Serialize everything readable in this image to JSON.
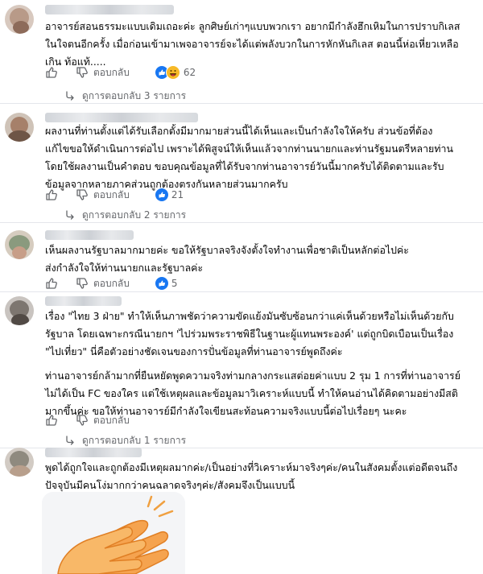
{
  "comments": [
    {
      "text_lines": [
        "อาจารย์สอนธรรมะแบบเดิมเถอะค่ะ ลูกศิษย์เก่าๆแบบพวกเรา อยากมีกำลังฮึกเหิมในการปราบกิเลส",
        "ในใจตนอีกครั้ง เมื่อก่อนเข้ามาเพจอาจารย์จะได้แต่พลังบวกในการหักหันกิเลส ตอนนี้ห่อเหี่ยวเหลือ",
        "เกิน ท้อแท้....."
      ],
      "reply_label": "ตอบกลับ",
      "reaction_count": "62",
      "replies_label": "ดูการตอบกลับ 3 รายการ"
    },
    {
      "text_lines": [
        "ผลงานที่ท่านตั้งแต่ได้รับเลือกตั้งมีมากมายส่วนนี้ได้เห็นและเป็นกำลังใจให้ครับ ส่วนข้อที่ต้อง",
        "แก้ไขขอให้ดำเนินการต่อไป เพราะได้พิสูจน์ให้เห็นแล้วจากท่านนายกและท่านรัฐมนตรีหลายท่าน",
        "โดยใช้ผลงานเป็นคำตอบ ขอบคุณข้อมูลที่ได้รับจากท่านอาจารย์วันนี้มากครับได้ติดตามและรับ",
        "ข้อมูลจากหลายภาคส่วนถูกต้องตรงกันหลายส่วนมากครับ"
      ],
      "reply_label": "ตอบกลับ",
      "reaction_count": "21",
      "replies_label": "ดูการตอบกลับ 2 รายการ"
    },
    {
      "text_lines": [
        "เห็นผลงานรัฐบาลมากมายค่ะ ขอให้รัฐบาลจริงจังตั้งใจทำงานเพื่อชาติเป็นหลักต่อไปค่ะ",
        "ส่งกำลังใจให้ท่านนายกและรัฐบาลค่ะ"
      ],
      "reply_label": "ตอบกลับ",
      "reaction_count": "5"
    },
    {
      "paragraph1_lines": [
        "เรื่อง \"ไทย 3 ฝ่าย\" ทำให้เห็นภาพชัดว่าความขัดแย้งมันซับซ้อนกว่าแค่เห็นด้วยหรือไม่เห็นด้วยกับ",
        "รัฐบาล โดยเฉพาะกรณีนายกฯ 'ไปร่วมพระราชพิธีในฐานะผู้แทนพระองค์' แต่ถูกบิดเบือนเป็นเรื่อง",
        "\"ไปเที่ยว\" นี่คือตัวอย่างชัดเจนของการปั่นข้อมูลที่ท่านอาจารย์พูดถึงค่ะ"
      ],
      "paragraph2_lines": [
        "ท่านอาจารย์กล้ามากที่ยืนหยัดพูดความจริงท่ามกลางกระแสต่อยค่าแบบ 2 รุม 1 การที่ท่านอาจารย์",
        "ไม่ได้เป็น FC ของใคร แต่ใช้เหตุผลและข้อมูลมาวิเคราะห์แบบนี้ ทำให้คนอ่านได้คิดตามอย่างมีสติ",
        "มากขึ้นค่ะ ขอให้ท่านอาจารย์มีกำลังใจเขียนสะท้อนความจริงแบบนี้ต่อไปเรื่อยๆ นะคะ"
      ],
      "reply_label": "ตอบกลับ",
      "replies_label": "ดูการตอบกลับ 1 รายการ"
    },
    {
      "text_lines": [
        "พูดได้ถูกใจและถูกต้องมีเหตุผลมากค่ะ/เป็นอย่างที่วิเคราะห์มาจริงๆค่ะ/คนในสังคมตั้งแต่อดีตจนถึง",
        "ปัจจุบันมีคนโง่มากกว่าคนฉลาดจริงๆค่ะ/สังคมจึงเป็นแบบนี้"
      ]
    }
  ],
  "icons": {
    "like": "thumb-up-icon",
    "dislike": "thumb-down-icon",
    "expand": "reply-arrow-icon",
    "reaction_like": "like-reaction-icon",
    "reaction_haha": "haha-reaction-icon"
  },
  "colors": {
    "link_blue": "#1877f2",
    "secondary_text": "#65676b",
    "haha_yellow": "#f7b928"
  }
}
